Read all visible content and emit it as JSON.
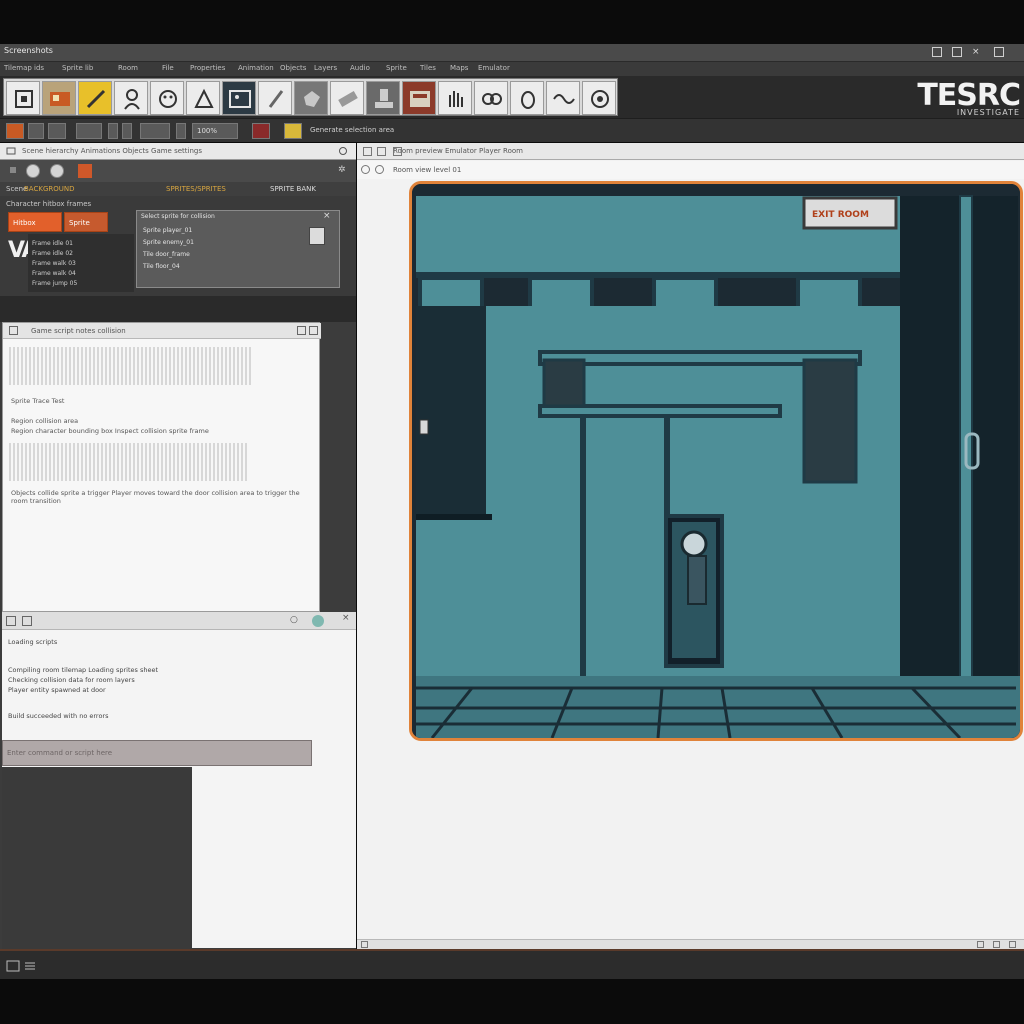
{
  "window": {
    "title": "Screenshots",
    "close_glyph": "×"
  },
  "menu": [
    "Tilemap ids",
    "Sprite lib",
    "Room",
    "File",
    "Properties",
    "Animation",
    "Objects",
    "Layers",
    "Audio",
    "Sprite",
    "Tiles",
    "Maps",
    "Emulator"
  ],
  "brand": {
    "name": "TESRC",
    "subtitle": "INVESTIGATE"
  },
  "toolbar2": {
    "label": "Generate selection area",
    "zoom": "100%"
  },
  "left_panel": {
    "tab_title": "Scene hierarchy  Animations  Objects  Game settings",
    "row3_labels": [
      "Scene",
      "BACKGROUND",
      "SPRITES/SPRITES",
      "SPRITE  BANK"
    ],
    "block_header": "Character  hitbox  frames",
    "buttons": [
      "Hitbox",
      "Sprite"
    ],
    "big_letter": "VAL",
    "list_items": [
      "Frame   idle   01",
      "Frame   idle   02",
      "Frame   walk  03",
      "Frame   walk  04",
      "Frame   jump  05"
    ],
    "popup_title": "Select sprite for collision",
    "popup_rows": [
      "Sprite   player_01",
      "Sprite   enemy_01",
      "Tile   door_frame",
      "Tile   floor_04"
    ]
  },
  "text_pane": {
    "title": "Game script  notes  collision",
    "lines": [
      "Sprite  Trace  Test",
      "Region  collision  area",
      "Region  character  bounding  box  Inspect collision  sprite  frame",
      "Objects  collide  sprite  a  trigger  Player  moves  toward  the  door  collision  area  to  trigger  the  room  transition"
    ]
  },
  "console": {
    "lines": [
      "Loading  scripts",
      "Compiling  room  tilemap  Loading  sprites  sheet",
      "Checking  collision  data  for  room  layers",
      "Player  entity  spawned  at  door",
      "Build  succeeded  with  no  errors"
    ],
    "input_placeholder": "Enter command  or  script  here"
  },
  "preview": {
    "tab_title": "Room  preview  Emulator  Player  Room",
    "subtitle": "Room  view  level  01",
    "sign_text": "EXIT  ROOM",
    "colors": {
      "wall": "#4e8f98",
      "wall_dark": "#1f3a45",
      "frame": "#e0833a",
      "floor": "#3f7680"
    }
  }
}
